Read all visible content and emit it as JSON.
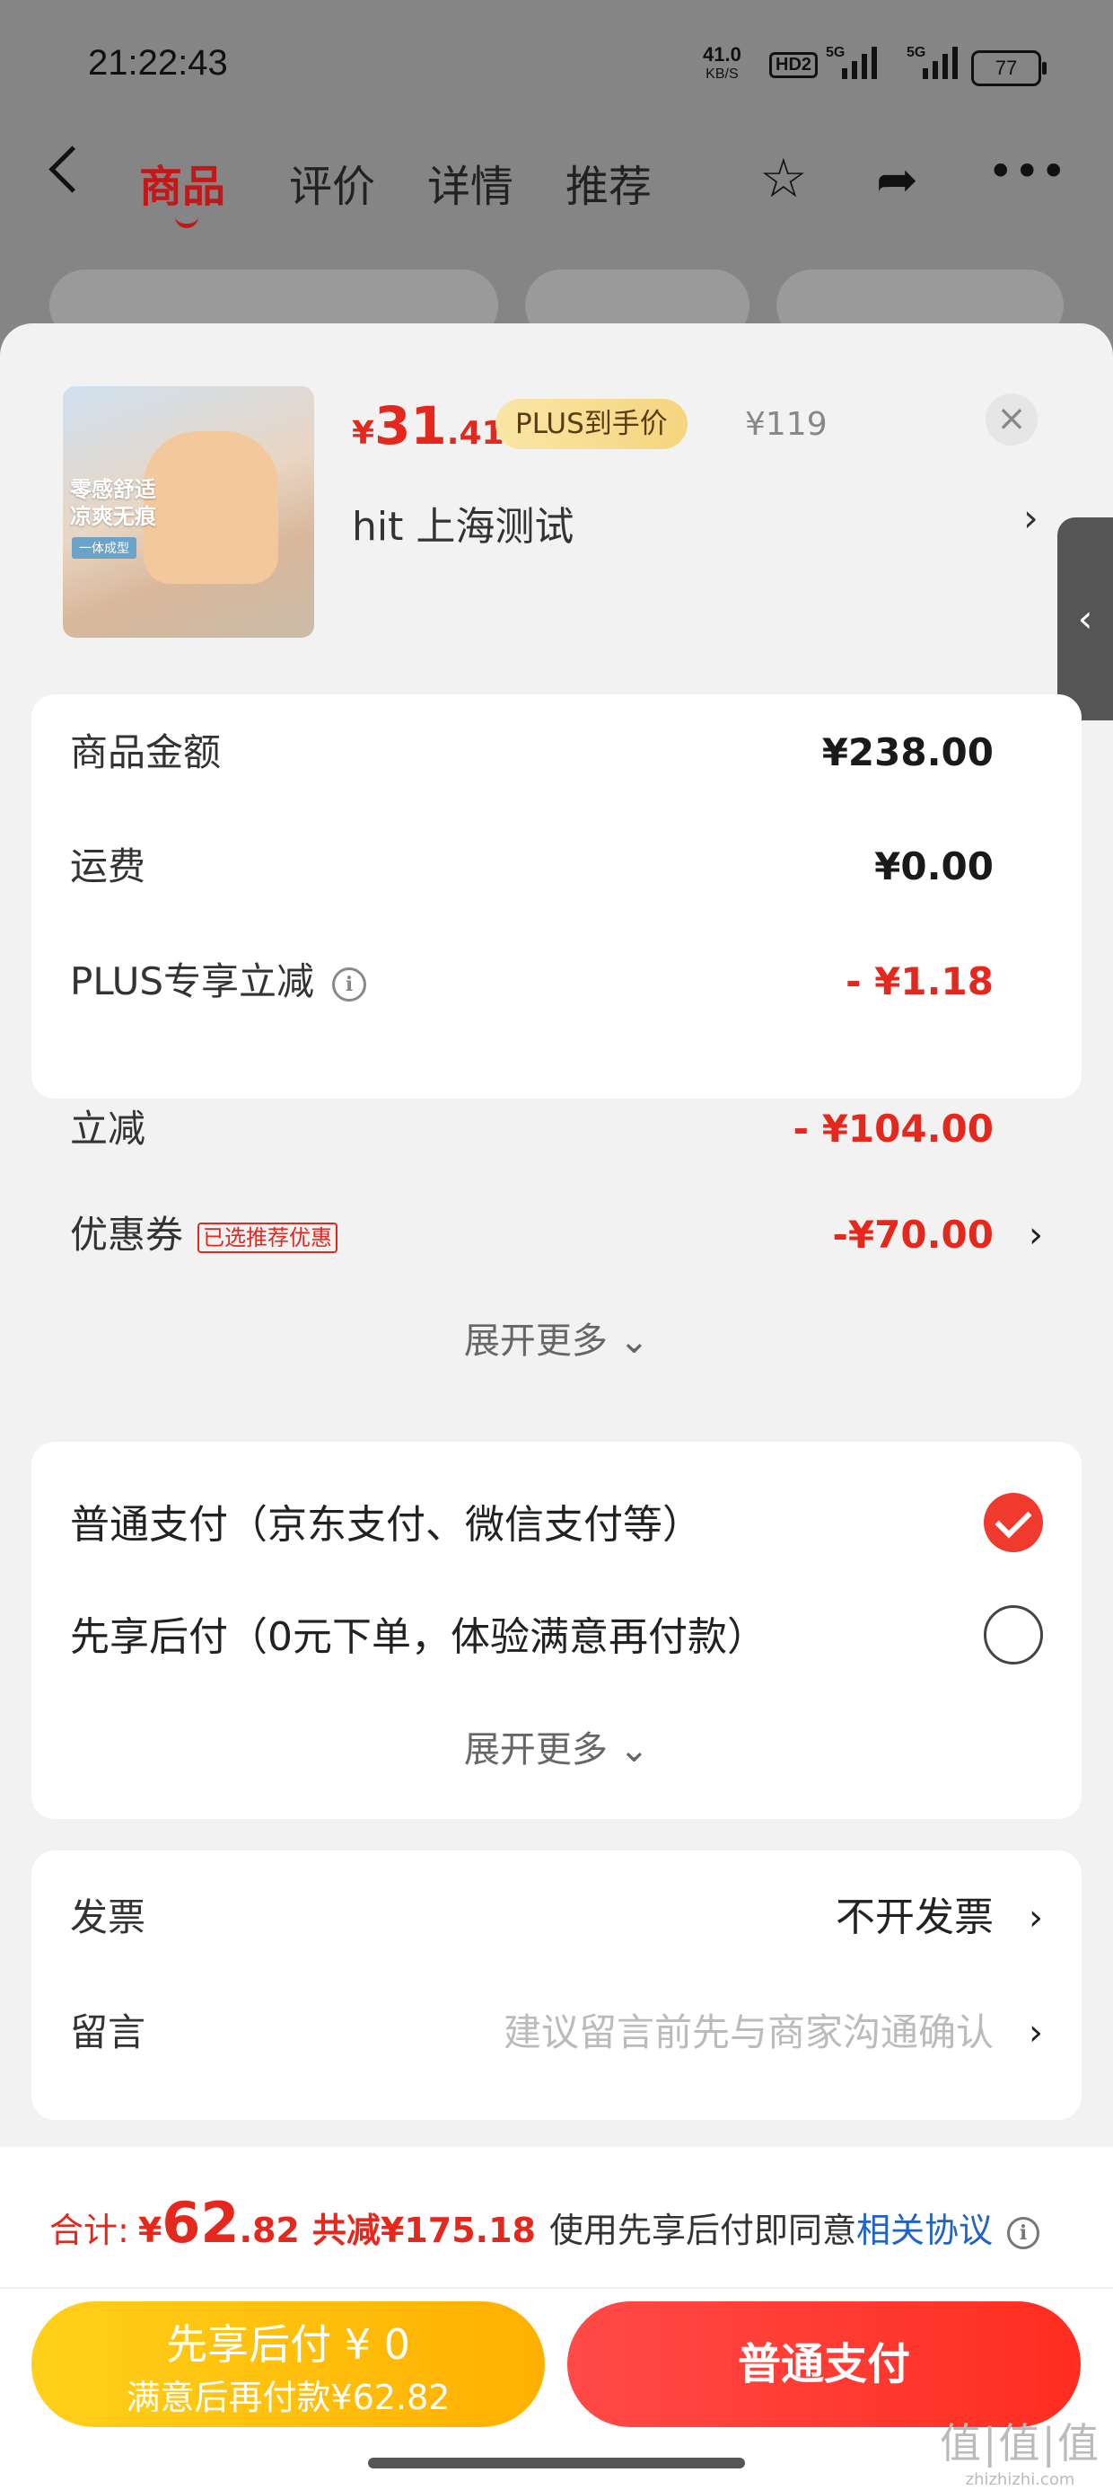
{
  "status_bar": {
    "time": "21:22:43",
    "net_speed": "41.0",
    "net_unit": "KB/S",
    "hd": "HD2",
    "sig1": "5G",
    "sig2": "5G",
    "battery": "77"
  },
  "nav": {
    "tabs": [
      "商品",
      "评价",
      "详情",
      "推荐"
    ],
    "active": "商品"
  },
  "product": {
    "price_symbol": "¥",
    "price_int": "31",
    "price_dec": ".41",
    "plus_badge": "PLUS到手价",
    "original_price": "¥119",
    "spec": "hit  上海测试",
    "image_text": "零感舒适\n凉爽无痕",
    "image_tag": "一体成型"
  },
  "summary": {
    "rows": [
      {
        "label": "商品金额",
        "value": "¥238.00"
      },
      {
        "label": "运费",
        "value": "¥0.00"
      },
      {
        "label": "PLUS专享立减",
        "value": "- ¥1.18"
      },
      {
        "label": "立减",
        "value": "- ¥104.00"
      },
      {
        "label": "优惠券",
        "badge": "已选推荐优惠",
        "value": "-¥70.00"
      }
    ],
    "expand": "展开更多"
  },
  "payment": {
    "options": [
      {
        "label": "普通支付（京东支付、微信支付等）",
        "selected": true
      },
      {
        "label": "先享后付（0元下单，体验满意再付款）",
        "selected": false
      }
    ],
    "expand": "展开更多"
  },
  "extra": {
    "invoice_label": "发票",
    "invoice_value": "不开发票",
    "message_label": "留言",
    "message_placeholder": "建议留言前先与商家沟通确认"
  },
  "footer": {
    "total_label": "合计:",
    "total_symbol": "¥",
    "total_int": "62",
    "total_dec": ".82",
    "total_save": "共减¥175.18",
    "agree_prefix": "使用先享后付即同意",
    "agree_link": "相关协议",
    "bnpl_line1": "先享后付 ¥ 0",
    "bnpl_line2": "满意后再付款¥62.82",
    "pay_button": "普通支付",
    "watermark": "值|值|值",
    "watermark_url": "zhizhizhi.com"
  },
  "colors": {
    "accent_red": "#e4281e",
    "link_blue": "#1f63c9",
    "bnpl_yellow": "#ffc20e"
  }
}
